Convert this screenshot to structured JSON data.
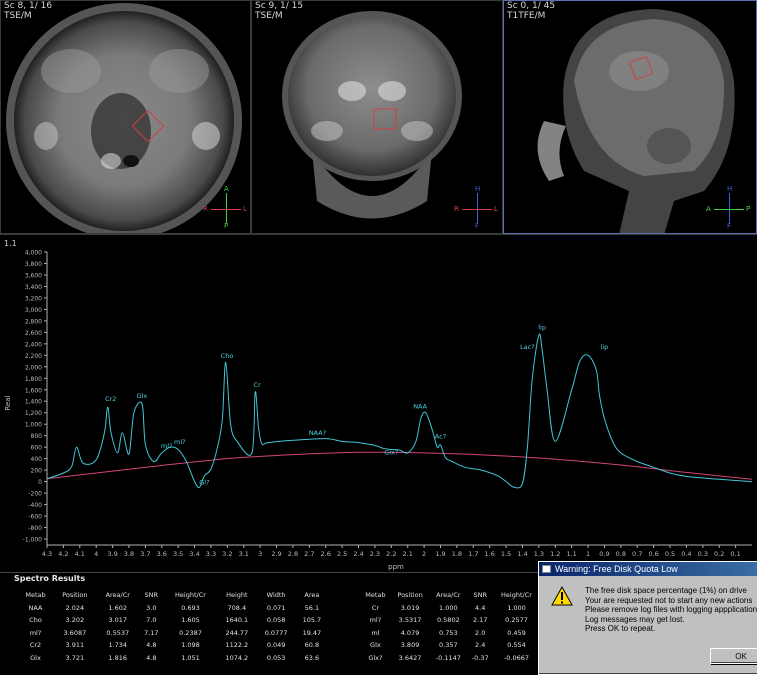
{
  "viewports": [
    {
      "series": "Sc 8, 1/ 16",
      "sequence": "TSE/M",
      "orientation": {
        "top": "A",
        "bottom": "P",
        "left": "R",
        "right": "L"
      }
    },
    {
      "series": "Sc 9, 1/ 15",
      "sequence": "TSE/M",
      "orientation": {
        "top": "H",
        "bottom": "F",
        "left": "R",
        "right": "L"
      }
    },
    {
      "series": "Sc 0, 1/ 45",
      "sequence": "T1TFE/M",
      "orientation": {
        "top": "H",
        "bottom": "F",
        "left": "A",
        "right": "P"
      }
    }
  ],
  "spectrum": {
    "id": "1.1",
    "y_axis_label": "Real",
    "x_axis_label": "ppm",
    "colors": {
      "spectrum": "#43c6d4",
      "baseline": "#d0447a",
      "axis": "#b0b0b0",
      "label": "#4fd0e0"
    }
  },
  "chart_data": {
    "type": "line",
    "xlabel": "ppm",
    "ylabel": "Real",
    "x_reversed": true,
    "xlim": [
      4.3,
      0.0
    ],
    "ylim": [
      -1000,
      4000
    ],
    "y_ticks": [
      4000,
      3800,
      3600,
      3400,
      3200,
      3000,
      2800,
      2600,
      2400,
      2200,
      2000,
      1800,
      1600,
      1400,
      1200,
      1000,
      800,
      600,
      400,
      200,
      0,
      -200,
      -400,
      -600,
      -800,
      -1000
    ],
    "y_tick_labels": [
      "4,000",
      "3,800",
      "3,600",
      "3,400",
      "3,200",
      "3,000",
      "2,800",
      "2,600",
      "2,400",
      "2,200",
      "2,000",
      "1,800",
      "1,600",
      "1,400",
      "1,200",
      "1,000",
      "800",
      "600",
      "400",
      "200",
      "0",
      "-200",
      "-400",
      "-600",
      "-800",
      "-1,000"
    ],
    "x_ticks": [
      4.3,
      4.2,
      4.1,
      4,
      3.9,
      3.8,
      3.7,
      3.6,
      3.5,
      3.4,
      3.3,
      3.2,
      3.1,
      3,
      2.9,
      2.8,
      2.7,
      2.6,
      2.5,
      2.4,
      2.3,
      2.2,
      2.1,
      2,
      1.9,
      1.8,
      1.7,
      1.6,
      1.5,
      1.4,
      1.3,
      1.2,
      1.1,
      1,
      0.9,
      0.8,
      0.7,
      0.6,
      0.5,
      0.4,
      0.3,
      0.2,
      0.1
    ],
    "x_tick_labels": [
      "4.3",
      "4.2",
      "4.1",
      "4",
      "3.9",
      "3.8",
      "3.7",
      "3.6",
      "3.5",
      "3.4",
      "3.3",
      "3.2",
      "3.1",
      "3",
      "2.9",
      "2.8",
      "2.7",
      "2.6",
      "2.5",
      "2.4",
      "2.3",
      "2.2",
      "2.1",
      "2",
      "1.9",
      "1.8",
      "1.7",
      "1.6",
      "1.5",
      "1.4",
      "1.3",
      "1.2",
      "1.1",
      "1",
      "0.9",
      "0.8",
      "0.7",
      "0.6",
      "0.5",
      "0.4",
      "0.3",
      "0.2",
      "0.1"
    ],
    "series": [
      {
        "name": "spectrum",
        "x": [
          4.3,
          4.2,
          4.15,
          4.12,
          4.08,
          4.0,
          3.95,
          3.93,
          3.91,
          3.87,
          3.84,
          3.8,
          3.77,
          3.72,
          3.7,
          3.65,
          3.6,
          3.55,
          3.5,
          3.45,
          3.4,
          3.37,
          3.34,
          3.3,
          3.26,
          3.23,
          3.21,
          3.18,
          3.14,
          3.05,
          3.03,
          3.01,
          2.99,
          2.95,
          2.8,
          2.6,
          2.5,
          2.4,
          2.3,
          2.25,
          2.2,
          2.15,
          2.1,
          2.05,
          2.02,
          1.99,
          1.95,
          1.92,
          1.9,
          1.87,
          1.83,
          1.75,
          1.65,
          1.55,
          1.5,
          1.45,
          1.4,
          1.37,
          1.34,
          1.3,
          1.28,
          1.25,
          1.2,
          1.1,
          1.05,
          1.0,
          0.95,
          0.93,
          0.9,
          0.85,
          0.8,
          0.7,
          0.6,
          0.5,
          0.4,
          0.2,
          0.0
        ],
        "values": [
          50,
          150,
          260,
          600,
          320,
          380,
          850,
          1300,
          860,
          500,
          850,
          480,
          1200,
          1350,
          650,
          350,
          500,
          600,
          560,
          350,
          0,
          -100,
          100,
          220,
          600,
          1100,
          2080,
          1000,
          700,
          500,
          1560,
          950,
          660,
          680,
          720,
          750,
          700,
          680,
          630,
          580,
          560,
          550,
          500,
          700,
          1100,
          1200,
          900,
          600,
          640,
          420,
          350,
          250,
          200,
          100,
          0,
          -100,
          -30,
          600,
          1800,
          2550,
          2300,
          1600,
          700,
          1600,
          2100,
          2200,
          1950,
          1500,
          1100,
          700,
          500,
          350,
          250,
          150,
          90,
          40,
          0
        ]
      },
      {
        "name": "baseline",
        "x": [
          4.3,
          4.0,
          3.6,
          3.2,
          2.8,
          2.4,
          2.0,
          1.6,
          1.2,
          0.8,
          0.4,
          0.0
        ],
        "values": [
          50,
          150,
          280,
          400,
          470,
          510,
          500,
          460,
          390,
          290,
          160,
          40
        ]
      }
    ],
    "annotations": [
      {
        "label": "Cr2",
        "x": 3.911,
        "y": 1350
      },
      {
        "label": "Glx",
        "x": 3.721,
        "y": 1400
      },
      {
        "label": "ml?",
        "x": 3.57,
        "y": 530
      },
      {
        "label": "ml?",
        "x": 3.49,
        "y": 600
      },
      {
        "label": "Gl?",
        "x": 3.34,
        "y": -100
      },
      {
        "label": "Cho",
        "x": 3.202,
        "y": 2100
      },
      {
        "label": "Cr",
        "x": 3.019,
        "y": 1600
      },
      {
        "label": "NAA?",
        "x": 2.65,
        "y": 760
      },
      {
        "label": "Glx?",
        "x": 2.2,
        "y": 420
      },
      {
        "label": "NAA",
        "x": 2.024,
        "y": 1220
      },
      {
        "label": "Ac?",
        "x": 1.9,
        "y": 700
      },
      {
        "label": "Lac?",
        "x": 1.37,
        "y": 2260
      },
      {
        "label": "lip",
        "x": 1.28,
        "y": 2600
      },
      {
        "label": "lip",
        "x": 0.9,
        "y": 2260
      }
    ]
  },
  "results": {
    "title": "Spectro Results",
    "left": {
      "headers": [
        "Metab",
        "Position",
        "Area/Cr",
        "SNR",
        "Height/Cr",
        "Height",
        "Width",
        "Area"
      ],
      "rows": [
        [
          "NAA",
          "2.024",
          "1.602",
          "3.0",
          "0.693",
          "708.4",
          "0.071",
          "56.1"
        ],
        [
          "Cho",
          "3.202",
          "3.017",
          "7.0",
          "1.605",
          "1640.1",
          "0.058",
          "105.7"
        ],
        [
          "ml?",
          "3.6087",
          "0.5537",
          "7.17",
          "0.2387",
          "244.77",
          "0.0777",
          "19.47"
        ],
        [
          "Cr2",
          "3.911",
          "1.734",
          "4.8",
          "1.098",
          "1122.2",
          "0.049",
          "60.8"
        ],
        [
          "Glx",
          "3.721",
          "1.816",
          "4.8",
          "1.051",
          "1074.2",
          "0.053",
          "63.6"
        ]
      ]
    },
    "right": {
      "headers": [
        "Metab",
        "Position",
        "Area/Cr",
        "SNR",
        "Height/Cr"
      ],
      "rows": [
        [
          "Cr",
          "3.019",
          "1.000",
          "4.4",
          "1.000"
        ],
        [
          "ml?",
          "3.5317",
          "0.5802",
          "2.17",
          "0.2577"
        ],
        [
          "ml",
          "4.079",
          "0.753",
          "2.0",
          "0.459"
        ],
        [
          "Glx",
          "3.809",
          "0.357",
          "2.4",
          "0.554"
        ],
        [
          "Glx?",
          "3.6427",
          "-0.1147",
          "-0.37",
          "-0.0667"
        ]
      ]
    }
  },
  "dialog": {
    "title": "Warning: Free Disk Quota Low",
    "lines": [
      "The free disk space percentage (1%) on drive",
      "Your are requested not to start any new actions",
      "Please remove log files with logging appplication",
      "Log messages may get lost.",
      "Press OK to repeat."
    ],
    "ok_label": "OK"
  }
}
